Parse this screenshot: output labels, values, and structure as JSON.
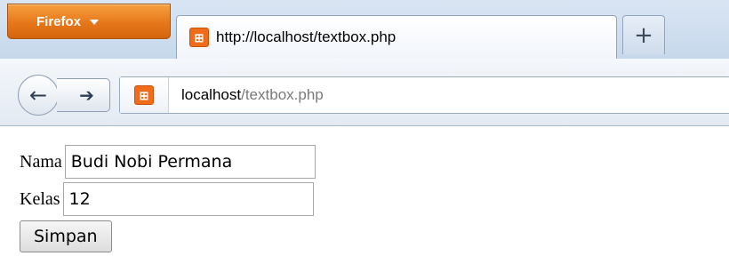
{
  "browser": {
    "menu_button_label": "Firefox",
    "tab_title": "http://localhost/textbox.php",
    "new_tab_symbol": "+",
    "url_host": "localhost",
    "url_path": "/textbox.php",
    "favicon_glyph": "⟴",
    "accent_color": "#e6771a"
  },
  "form": {
    "fields": [
      {
        "label": "Nama",
        "value": "Budi Nobi Permana"
      },
      {
        "label": "Kelas",
        "value": "12"
      }
    ],
    "submit_label": "Simpan"
  }
}
